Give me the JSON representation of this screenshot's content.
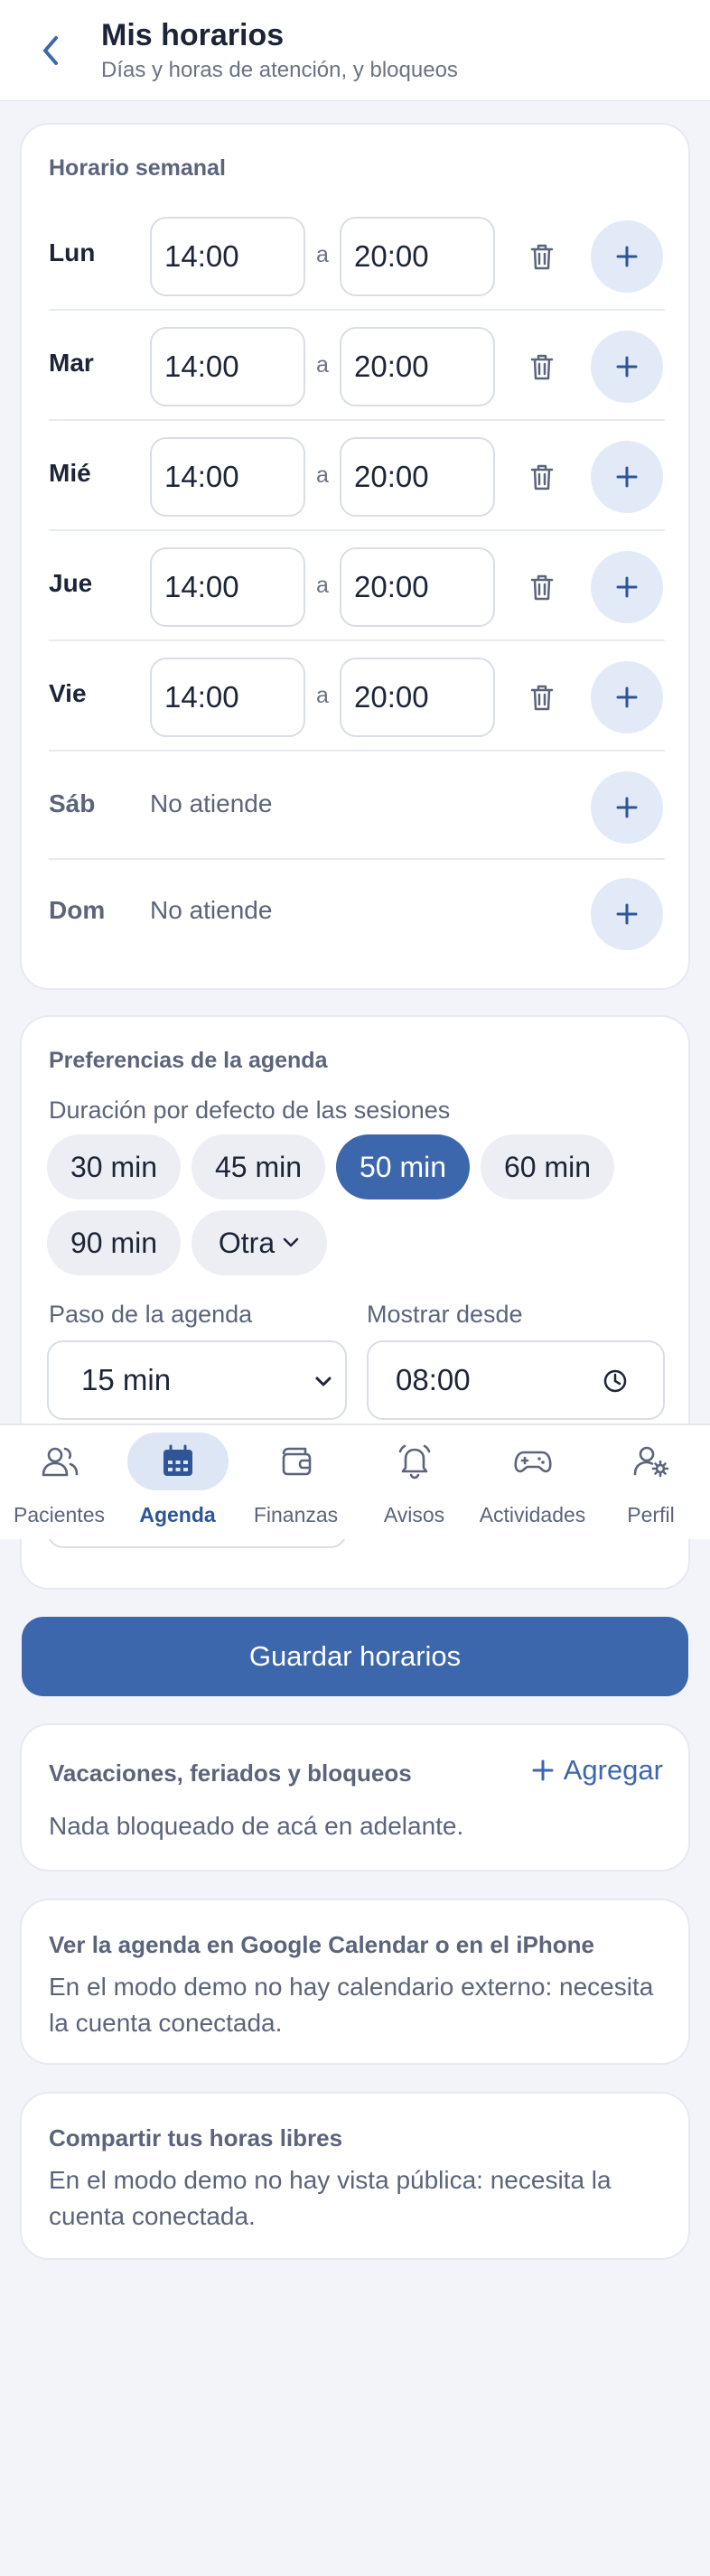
{
  "header": {
    "title": "Mis horarios",
    "subtitle": "Días y horas de atención, y bloqueos"
  },
  "weekly": {
    "title": "Horario semanal",
    "sep": "a",
    "days": [
      {
        "label": "Lun",
        "from": "14:00",
        "to": "20:00"
      },
      {
        "label": "Mar",
        "from": "14:00",
        "to": "20:00"
      },
      {
        "label": "Mié",
        "from": "14:00",
        "to": "20:00"
      },
      {
        "label": "Jue",
        "from": "14:00",
        "to": "20:00"
      },
      {
        "label": "Vie",
        "from": "14:00",
        "to": "20:00"
      }
    ],
    "off_days": [
      {
        "label": "Sáb",
        "status": "No atiende"
      },
      {
        "label": "Dom",
        "status": "No atiende"
      }
    ]
  },
  "prefs": {
    "title": "Preferencias de la agenda",
    "duration_label": "Duración por defecto de las sesiones",
    "chips": [
      "30 min",
      "45 min",
      "50 min",
      "60 min",
      "90 min",
      "Otra"
    ],
    "selected_chip": "50 min",
    "step_label": "Paso de la agenda",
    "step_value": "15 min",
    "show_from_label": "Mostrar desde",
    "show_from_value": "08:00"
  },
  "nav": {
    "items": [
      "Pacientes",
      "Agenda",
      "Finanzas",
      "Avisos",
      "Actividades",
      "Perfil"
    ],
    "active": "Agenda"
  },
  "save_label": "Guardar horarios",
  "blocks": {
    "title": "Vacaciones, feriados y bloqueos",
    "add_label": "Agregar",
    "empty": "Nada bloqueado de acá en adelante."
  },
  "calendar": {
    "title": "Ver la agenda en Google Calendar o en el iPhone",
    "text": "En el modo demo no hay calendario externo: necesita la cuenta conectada."
  },
  "share": {
    "title": "Compartir tus horas libres",
    "text": "En el modo demo no hay vista pública: necesita la cuenta conectada."
  },
  "colors": {
    "accent": "#3c67ad",
    "accent_light": "#e2eaf7",
    "background": "#f2f4f9"
  },
  "icons": [
    "back-arrow-icon",
    "trash-icon",
    "plus-icon",
    "chevron-down-icon",
    "clock-icon",
    "users-icon",
    "calendar-icon",
    "wallet-icon",
    "bell-icon",
    "gamepad-icon",
    "user-gear-icon"
  ]
}
